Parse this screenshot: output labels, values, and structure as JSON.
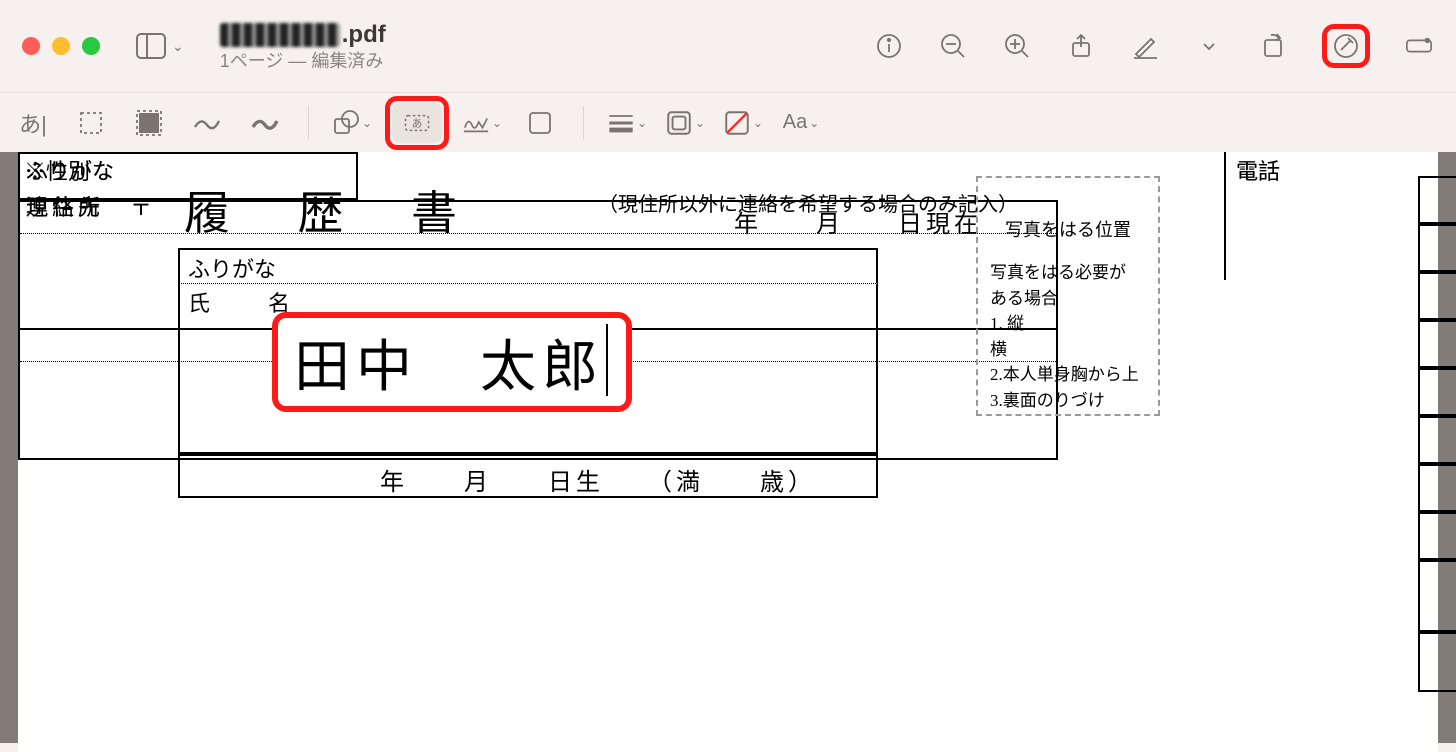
{
  "window": {
    "file_ext": ".pdf",
    "subtitle": "1ページ — 編集済み"
  },
  "tooltip": {
    "text_tool": "テキスト"
  },
  "markup_toolbar": {
    "font_style_label": "Aa"
  },
  "doc": {
    "title": "履 歴 書",
    "date_year": "年",
    "date_month": "月",
    "date_day_present": "日現在",
    "photo": {
      "title": "写真をはる位置",
      "line1": "写真をはる必要が",
      "line2": "ある場合",
      "line3": "1.   縦",
      "line4": "     横",
      "line5": "2.本人単身胸から上",
      "line6": "3.裏面のりづけ"
    },
    "labels": {
      "furigana": "ふりがな",
      "name": "氏　名",
      "birth": "年　　月　　日生　　（満　　歳）",
      "sex": "※性別",
      "address": "現住所　〒",
      "contact": "連絡先　〒",
      "contact_note": "（現住所以外に連絡を希望する場合のみ記入）",
      "tel": "電話"
    },
    "input": {
      "name_value": "田中　太郎"
    }
  }
}
